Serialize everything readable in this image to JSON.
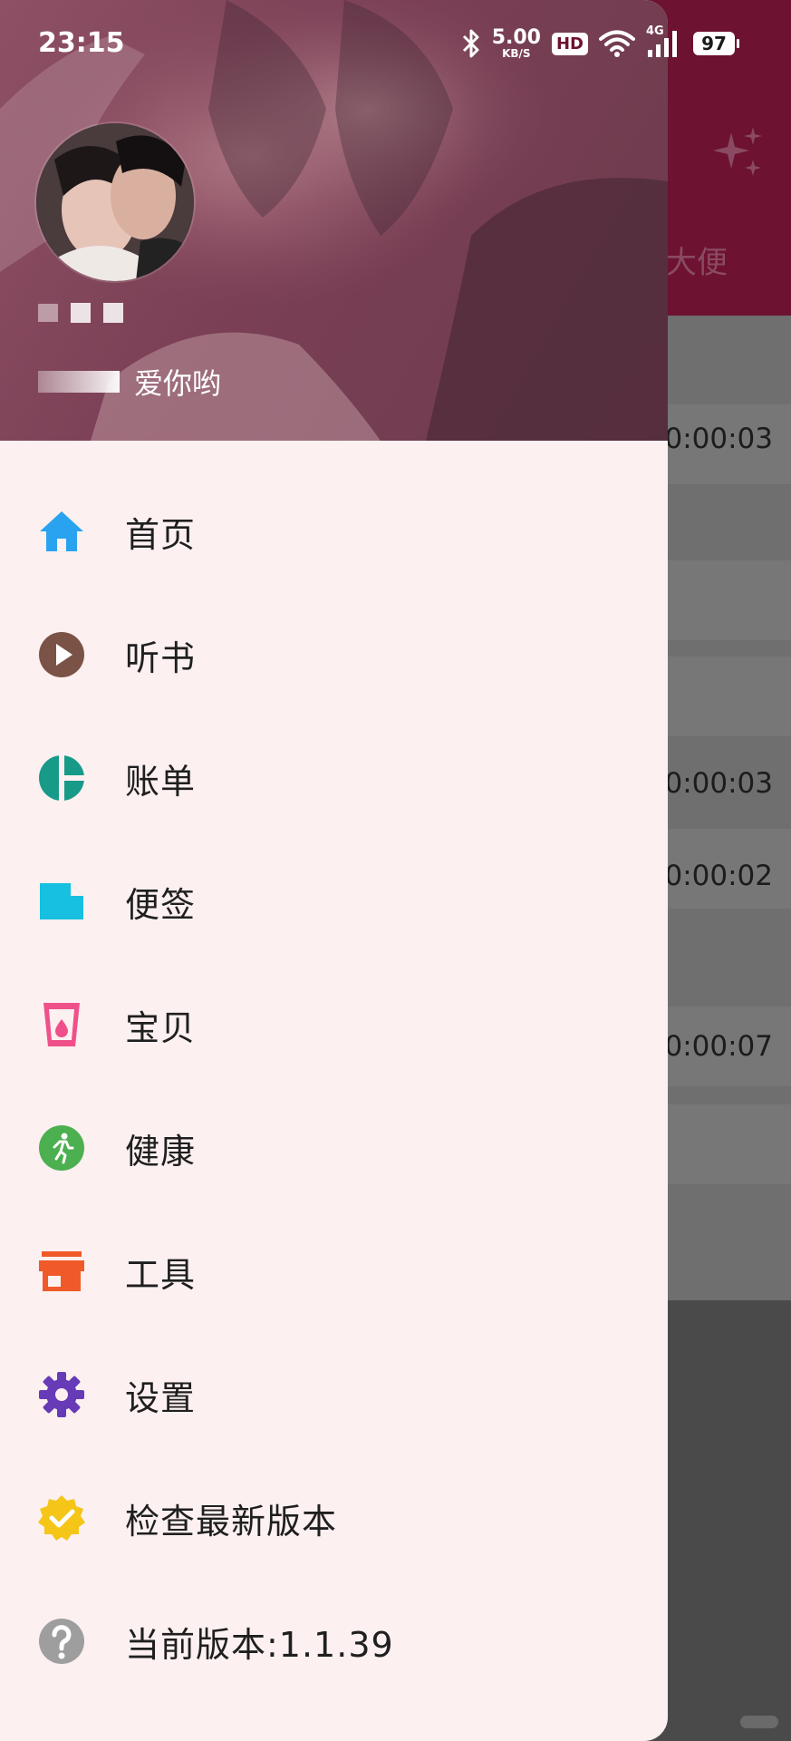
{
  "status_bar": {
    "time": "23:15",
    "net_speed_value": "5.00",
    "net_speed_unit": "KB/S",
    "hd_label": "HD",
    "network_type": "4G",
    "battery": "97"
  },
  "background_app": {
    "tab_label": "大便",
    "rows": [
      {
        "time": "0:00:03"
      },
      {
        "time": "0:00:03"
      },
      {
        "time": "0:00:02"
      },
      {
        "time": "0:00:07"
      }
    ],
    "accent_color": "#6d1230"
  },
  "drawer": {
    "profile": {
      "motto": "爱你哟"
    },
    "menu": [
      {
        "label": "首页",
        "icon": "home-icon",
        "color": "#29a3f0"
      },
      {
        "label": "听书",
        "icon": "play-circle-icon",
        "color": "#7a5346"
      },
      {
        "label": "账单",
        "icon": "pie-chart-icon",
        "color": "#179a88"
      },
      {
        "label": "便签",
        "icon": "note-icon",
        "color": "#17bfe0"
      },
      {
        "label": "宝贝",
        "icon": "baby-cup-icon",
        "color": "#f0508a"
      },
      {
        "label": "健康",
        "icon": "running-icon",
        "color": "#4caf50"
      },
      {
        "label": "工具",
        "icon": "store-icon",
        "color": "#f05a28"
      },
      {
        "label": "设置",
        "icon": "gear-icon",
        "color": "#673ab7"
      },
      {
        "label": "检查最新版本",
        "icon": "verified-badge-icon",
        "color": "#f5c518"
      },
      {
        "label": "当前版本:1.1.39",
        "icon": "help-icon",
        "color": "#9e9e9e"
      }
    ]
  }
}
